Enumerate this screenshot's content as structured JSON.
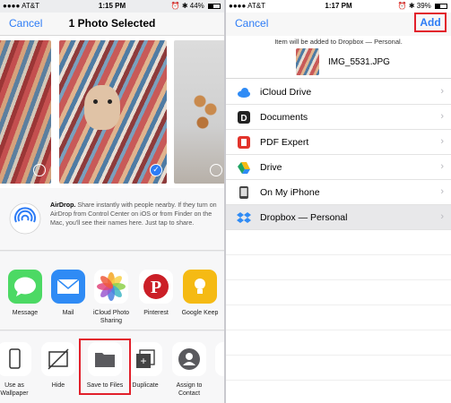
{
  "left": {
    "status": {
      "carrier": "●●●● AT&T",
      "time": "1:15 PM",
      "battery": "⏰ ✱ 44%",
      "battery_level": 0.44
    },
    "nav": {
      "cancel": "Cancel",
      "title": "1 Photo Selected"
    },
    "photos": [
      {
        "selected": false
      },
      {
        "selected": true
      },
      {
        "selected": false
      }
    ],
    "airdrop": {
      "title": "AirDrop.",
      "text": " Share instantly with people nearby. If they turn on AirDrop from Control Center on iOS or from Finder on the Mac, you'll see their names here. Just tap to share."
    },
    "apps": [
      {
        "label": "Message",
        "icon": "messages-icon",
        "color": "#4cd964"
      },
      {
        "label": "Mail",
        "icon": "mail-icon",
        "color": "#2f8bf5"
      },
      {
        "label": "iCloud Photo Sharing",
        "icon": "photos-icon",
        "color": "#ffffff"
      },
      {
        "label": "Pinterest",
        "icon": "pinterest-icon",
        "color": "#ffffff"
      },
      {
        "label": "Google Keep",
        "icon": "google-keep-icon",
        "color": "#f5ba14"
      }
    ],
    "actions": [
      {
        "label": "Use as Wallpaper",
        "icon": "iphone-icon"
      },
      {
        "label": "Hide",
        "icon": "hide-icon"
      },
      {
        "label": "Save to Files",
        "icon": "folder-icon"
      },
      {
        "label": "Duplicate",
        "icon": "duplicate-icon"
      },
      {
        "label": "Assign to Contact",
        "icon": "contact-icon"
      }
    ]
  },
  "right": {
    "status": {
      "carrier": "●●●● AT&T",
      "time": "1:17 PM",
      "battery": "⏰ ✱ 39%",
      "battery_level": 0.39
    },
    "nav": {
      "cancel": "Cancel",
      "add": "Add"
    },
    "note": "Item will be added to Dropbox — Personal.",
    "filename": "IMG_5531.JPG",
    "locations": [
      {
        "label": "iCloud Drive",
        "icon": "icloud-icon",
        "color": "#2f8bf5"
      },
      {
        "label": "Documents",
        "icon": "documents-icon",
        "color": "#222222"
      },
      {
        "label": "PDF Expert",
        "icon": "pdf-expert-icon",
        "color": "#e2332b"
      },
      {
        "label": "Drive",
        "icon": "google-drive-icon",
        "color": "#1fa463"
      },
      {
        "label": "On My iPhone",
        "icon": "iphone-icon",
        "color": "#444444"
      },
      {
        "label": "Dropbox — Personal",
        "icon": "dropbox-icon",
        "color": "#2f8bf5",
        "selected": true
      }
    ]
  },
  "colors": {
    "accent": "#2d7cf6",
    "highlight": "#e2202b"
  }
}
